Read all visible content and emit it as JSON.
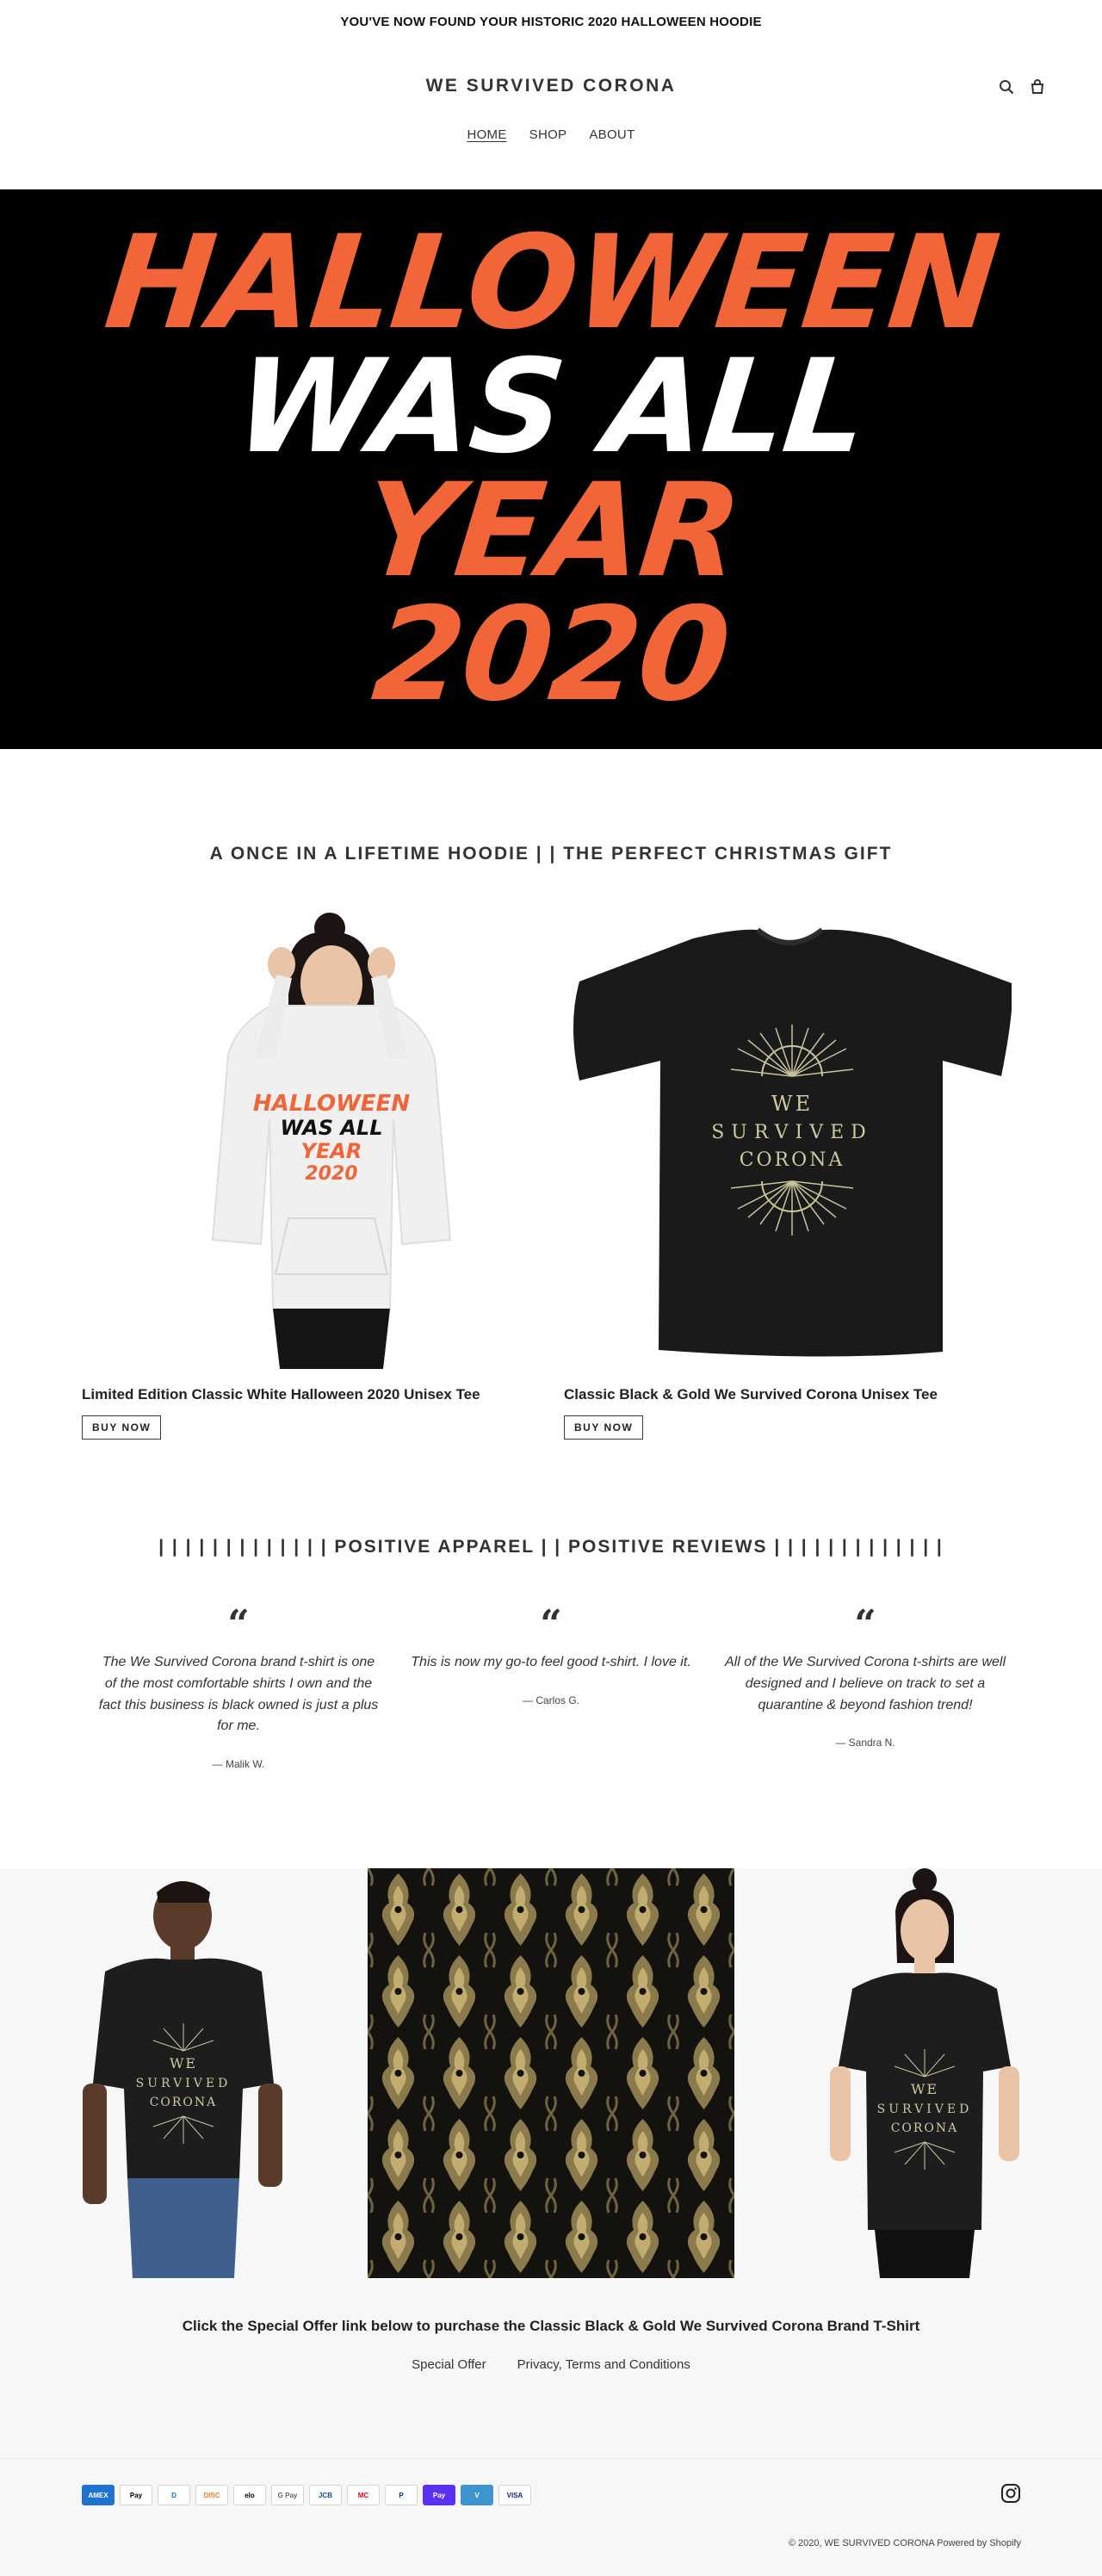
{
  "announcement": "YOU'VE NOW FOUND YOUR HISTORIC 2020 HALLOWEEN HOODIE",
  "header": {
    "logo": "WE SURVIVED CORONA",
    "nav": [
      "HOME",
      "SHOP",
      "ABOUT"
    ],
    "icons": [
      "search-icon",
      "cart-icon"
    ]
  },
  "hero": {
    "lines": [
      "HALLOWEEN",
      "WAS ALL",
      "YEAR",
      "2020"
    ],
    "colors": {
      "orange": "#f26539",
      "white": "#ffffff",
      "background": "#000000"
    }
  },
  "featured": {
    "title": "A ONCE IN A LIFETIME HOODIE | | THE PERFECT CHRISTMAS GIFT",
    "products": [
      {
        "title": "Limited Edition Classic White Halloween 2020 Unisex Tee",
        "button": "BUY NOW",
        "print_lines": [
          "HALLOWEEN",
          "WAS ALL",
          "YEAR",
          "2020"
        ]
      },
      {
        "title": "Classic Black & Gold We Survived Corona Unisex Tee",
        "button": "BUY NOW",
        "print_lines": [
          "WE",
          "SURVIVED",
          "CORONA"
        ]
      }
    ]
  },
  "reviews": {
    "title": "| | | | | | | | | | | | | POSITIVE APPAREL | | POSITIVE REVIEWS | | | | | | | | | | | | |",
    "items": [
      {
        "text": "The We Survived Corona brand t-shirt is one of the most comfortable shirts I own and the fact this business is black owned is just a plus for me.",
        "author": "— Malik W."
      },
      {
        "text": "This is now my go-to feel good t-shirt. I love it.",
        "author": "— Carlos G."
      },
      {
        "text": "All of the We Survived Corona t-shirts are well designed and I believe on track to set a quarantine & beyond fashion trend!",
        "author": "— Sandra N."
      }
    ]
  },
  "gallery": {
    "shirt_print": [
      "WE",
      "SURVIVED",
      "CORONA"
    ],
    "offer_text": "Click the Special Offer link below to purchase the Classic Black & Gold We Survived Corona Brand T-Shirt",
    "links": [
      "Special Offer",
      "Privacy, Terms and Conditions"
    ]
  },
  "footer": {
    "payments": [
      {
        "name": "AMEX",
        "bg": "#1f72cd",
        "fg": "#ffffff"
      },
      {
        "name": "Pay",
        "bg": "#ffffff",
        "fg": "#000000"
      },
      {
        "name": "D",
        "bg": "#ffffff",
        "fg": "#0079be"
      },
      {
        "name": "DISC",
        "bg": "#ffffff",
        "fg": "#f58220"
      },
      {
        "name": "elo",
        "bg": "#ffffff",
        "fg": "#000000"
      },
      {
        "name": "G Pay",
        "bg": "#ffffff",
        "fg": "#5f6368"
      },
      {
        "name": "JCB",
        "bg": "#ffffff",
        "fg": "#0e4c96"
      },
      {
        "name": "MC",
        "bg": "#ffffff",
        "fg": "#eb001b"
      },
      {
        "name": "P",
        "bg": "#ffffff",
        "fg": "#003087"
      },
      {
        "name": "Pay",
        "bg": "#5a31f4",
        "fg": "#ffffff"
      },
      {
        "name": "V",
        "bg": "#3d95ce",
        "fg": "#ffffff"
      },
      {
        "name": "VISA",
        "bg": "#ffffff",
        "fg": "#1a1f71"
      }
    ],
    "copyright": "© 2020, WE SURVIVED CORONA Powered by Shopify",
    "social_icon": "instagram-icon"
  }
}
